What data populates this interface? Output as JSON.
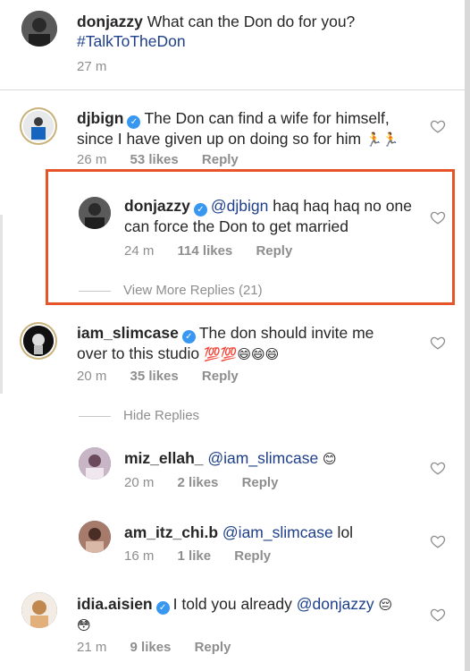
{
  "post": {
    "username": "donjazzy",
    "caption": "What can the Don do for you?",
    "hashtag": "#TalkToTheDon",
    "time": "27 m"
  },
  "comments": [
    {
      "username": "djbign",
      "text": "The Don can find a wife for himself, since I have given up on doing so for him",
      "emoji": "🏃🏃",
      "time": "26 m",
      "likes": "53 likes",
      "reply": "Reply"
    },
    {
      "username": "donjazzy",
      "mention": "@djbign",
      "text": " haq haq haq no one can force the Don to get married",
      "time": "24 m",
      "likes": "114 likes",
      "reply": "Reply",
      "view_more": "View More Replies (21)"
    },
    {
      "username": "iam_slimcase",
      "text": "The don should invite me over to this studio",
      "emoji": "💯💯😄😄😄",
      "time": "20 m",
      "likes": "35 likes",
      "reply": "Reply",
      "hide_replies": "Hide Replies"
    },
    {
      "username": "miz_ellah_",
      "mention": "@iam_slimcase",
      "emoji": "😊",
      "time": "20 m",
      "likes": "2 likes",
      "reply": "Reply"
    },
    {
      "username": "am_itz_chi.b",
      "mention": "@iam_slimcase",
      "text": " lol",
      "time": "16 m",
      "likes": "1 like",
      "reply": "Reply"
    },
    {
      "username": "idia.aisien",
      "text": "I told you already",
      "mention": "@donjazzy",
      "emoji": "😔",
      "emoji2": "😳",
      "time": "21 m",
      "likes": "9 likes",
      "reply": "Reply"
    }
  ],
  "verified_glyph": "✓",
  "colors": {
    "highlight": "#e8542a",
    "mention": "#1e3f8a",
    "verified": "#3897f0",
    "meta": "#8e8e8e"
  }
}
